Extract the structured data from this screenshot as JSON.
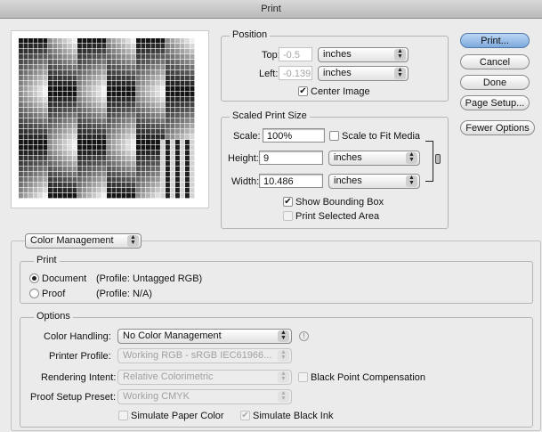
{
  "window": {
    "title": "Print"
  },
  "buttons": {
    "print": "Print...",
    "cancel": "Cancel",
    "done": "Done",
    "page_setup": "Page Setup...",
    "fewer_options": "Fewer Options"
  },
  "position": {
    "title": "Position",
    "top_label": "Top:",
    "top_value": "-0.5",
    "top_unit": "inches",
    "left_label": "Left:",
    "left_value": "-0.139",
    "left_unit": "inches",
    "center_image": "Center Image"
  },
  "scaled": {
    "title": "Scaled Print Size",
    "scale_label": "Scale:",
    "scale_value": "100%",
    "scale_to_fit": "Scale to Fit Media",
    "height_label": "Height:",
    "height_value": "9",
    "height_unit": "inches",
    "width_label": "Width:",
    "width_value": "10.486",
    "width_unit": "inches",
    "show_bounding_box": "Show Bounding Box",
    "print_selected_area": "Print Selected Area"
  },
  "section_select": "Color Management",
  "print_group": {
    "title": "Print",
    "document_label": "Document",
    "document_profile": "(Profile: Untagged RGB)",
    "proof_label": "Proof",
    "proof_profile": "(Profile: N/A)"
  },
  "options": {
    "title": "Options",
    "color_handling_label": "Color Handling:",
    "color_handling_value": "No Color Management",
    "printer_profile_label": "Printer Profile:",
    "printer_profile_value": "Working RGB - sRGB IEC61966...",
    "rendering_intent_label": "Rendering Intent:",
    "rendering_intent_value": "Relative Colorimetric",
    "black_point": "Black Point Compensation",
    "proof_setup_label": "Proof Setup Preset:",
    "proof_setup_value": "Working CMYK",
    "simulate_paper": "Simulate Paper Color",
    "simulate_black": "Simulate Black Ink"
  },
  "icons": {
    "info": "info-icon",
    "link": "chain-link-icon",
    "popup_arrows": "up-down-arrows-icon",
    "check": "checkmark-icon"
  }
}
